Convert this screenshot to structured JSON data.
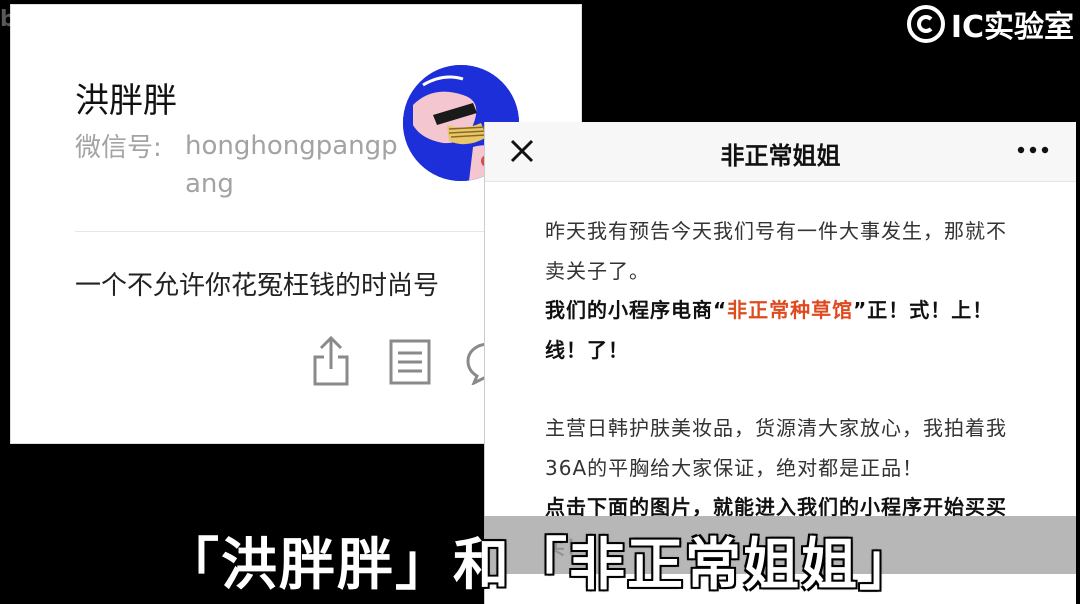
{
  "watermark_left": "bilibili",
  "watermark_right": "IC实验室",
  "profile": {
    "name": "洪胖胖",
    "wechat_label": "微信号:",
    "wechat_id": "honghongpangpang",
    "description": "一个不允许你花冤枉钱的时尚号"
  },
  "article": {
    "title": "非正常姐姐",
    "para1": "昨天我有预告今天我们号有一件大事发生，那就不卖关子了。",
    "para2_prefix": "我们的小程序电商“",
    "para2_highlight": "非正常种草馆",
    "para2_suffix": "”正！式！上！线！了！",
    "para3": "主营日韩护肤美妆品，货源清大家放心，我拍着我36A的平胸给大家保证，绝对都是正品！",
    "para4": "点击下面的图片，就能进入我们的小程序开始买买买！"
  },
  "subtitle": "「洪胖胖」和「非正常姐姐」",
  "colors": {
    "accent_red": "#e04a1f",
    "avatar_blue": "#1d2fd8",
    "muted_gray": "#a3a3a3"
  }
}
